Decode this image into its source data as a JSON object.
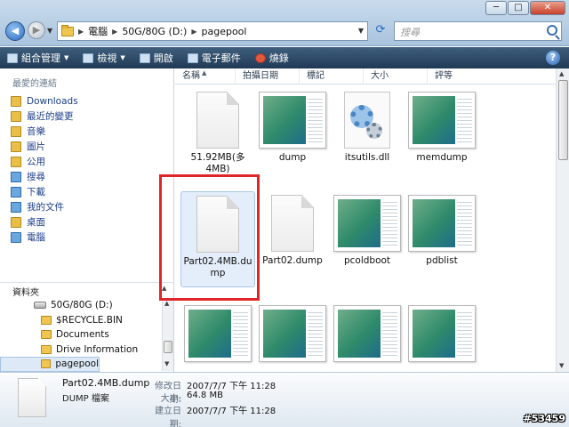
{
  "window": {
    "minimize": "─",
    "maximize": "□",
    "close": "✕"
  },
  "address": {
    "crumbs": [
      "電腦",
      "50G/80G (D:)",
      "pagepool"
    ]
  },
  "search": {
    "placeholder": "搜尋"
  },
  "toolbar": {
    "organize": "組合管理",
    "views": "檢視",
    "open": "開啟",
    "email": "電子郵件",
    "burn": "燒錄",
    "help": "?"
  },
  "sidebar": {
    "recent_label": "最愛的連結",
    "favorites": [
      "Downloads",
      "最近的變更",
      "音樂",
      "圖片",
      "公用",
      "搜尋",
      "下載",
      "我的文件",
      "桌面",
      "電腦"
    ],
    "folders_label": "資料夾",
    "tree": [
      "50G/80G (D:)",
      "$RECYCLE.BIN",
      "Documents",
      "Drive Information",
      "pagepool"
    ]
  },
  "columns": [
    "名稱",
    "拍攝日期",
    "標記",
    "大小",
    "評等"
  ],
  "files": [
    {
      "name": "51.92MB(多4MB)",
      "kind": "doc"
    },
    {
      "name": "dump",
      "kind": "thumb"
    },
    {
      "name": "itsutils.dll",
      "kind": "gear"
    },
    {
      "name": "memdump",
      "kind": "thumb"
    },
    {
      "name": "Part02.4MB.dump",
      "kind": "doc"
    },
    {
      "name": "Part02.dump",
      "kind": "doc"
    },
    {
      "name": "pcoldboot",
      "kind": "thumb"
    },
    {
      "name": "pdblist",
      "kind": "thumb"
    }
  ],
  "details": {
    "name": "Part02.4MB.dump",
    "type": "DUMP 檔案",
    "modified_label": "修改日期:",
    "modified": "2007/7/7 下午 11:28",
    "size_label": "大小:",
    "size": "64.8 MB",
    "created_label": "建立日期:",
    "created": "2007/7/7 下午 11:28"
  },
  "watermark": "#53459"
}
